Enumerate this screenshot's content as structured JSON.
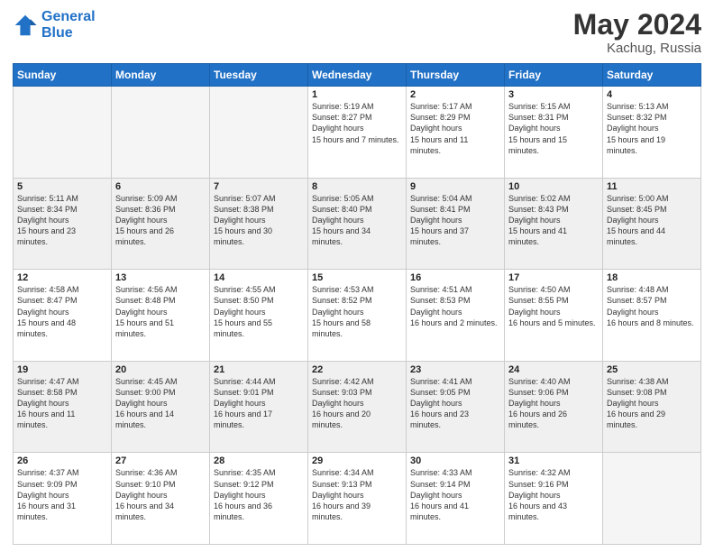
{
  "header": {
    "logo_line1": "General",
    "logo_line2": "Blue",
    "title": "May 2024",
    "location": "Kachug, Russia"
  },
  "days_of_week": [
    "Sunday",
    "Monday",
    "Tuesday",
    "Wednesday",
    "Thursday",
    "Friday",
    "Saturday"
  ],
  "weeks": [
    [
      {
        "day": "",
        "sunrise": "",
        "sunset": "",
        "daylight": "",
        "empty": true
      },
      {
        "day": "",
        "sunrise": "",
        "sunset": "",
        "daylight": "",
        "empty": true
      },
      {
        "day": "",
        "sunrise": "",
        "sunset": "",
        "daylight": "",
        "empty": true
      },
      {
        "day": "1",
        "sunrise": "5:19 AM",
        "sunset": "8:27 PM",
        "daylight": "15 hours and 7 minutes."
      },
      {
        "day": "2",
        "sunrise": "5:17 AM",
        "sunset": "8:29 PM",
        "daylight": "15 hours and 11 minutes."
      },
      {
        "day": "3",
        "sunrise": "5:15 AM",
        "sunset": "8:31 PM",
        "daylight": "15 hours and 15 minutes."
      },
      {
        "day": "4",
        "sunrise": "5:13 AM",
        "sunset": "8:32 PM",
        "daylight": "15 hours and 19 minutes."
      }
    ],
    [
      {
        "day": "5",
        "sunrise": "5:11 AM",
        "sunset": "8:34 PM",
        "daylight": "15 hours and 23 minutes."
      },
      {
        "day": "6",
        "sunrise": "5:09 AM",
        "sunset": "8:36 PM",
        "daylight": "15 hours and 26 minutes."
      },
      {
        "day": "7",
        "sunrise": "5:07 AM",
        "sunset": "8:38 PM",
        "daylight": "15 hours and 30 minutes."
      },
      {
        "day": "8",
        "sunrise": "5:05 AM",
        "sunset": "8:40 PM",
        "daylight": "15 hours and 34 minutes."
      },
      {
        "day": "9",
        "sunrise": "5:04 AM",
        "sunset": "8:41 PM",
        "daylight": "15 hours and 37 minutes."
      },
      {
        "day": "10",
        "sunrise": "5:02 AM",
        "sunset": "8:43 PM",
        "daylight": "15 hours and 41 minutes."
      },
      {
        "day": "11",
        "sunrise": "5:00 AM",
        "sunset": "8:45 PM",
        "daylight": "15 hours and 44 minutes."
      }
    ],
    [
      {
        "day": "12",
        "sunrise": "4:58 AM",
        "sunset": "8:47 PM",
        "daylight": "15 hours and 48 minutes."
      },
      {
        "day": "13",
        "sunrise": "4:56 AM",
        "sunset": "8:48 PM",
        "daylight": "15 hours and 51 minutes."
      },
      {
        "day": "14",
        "sunrise": "4:55 AM",
        "sunset": "8:50 PM",
        "daylight": "15 hours and 55 minutes."
      },
      {
        "day": "15",
        "sunrise": "4:53 AM",
        "sunset": "8:52 PM",
        "daylight": "15 hours and 58 minutes."
      },
      {
        "day": "16",
        "sunrise": "4:51 AM",
        "sunset": "8:53 PM",
        "daylight": "16 hours and 2 minutes."
      },
      {
        "day": "17",
        "sunrise": "4:50 AM",
        "sunset": "8:55 PM",
        "daylight": "16 hours and 5 minutes."
      },
      {
        "day": "18",
        "sunrise": "4:48 AM",
        "sunset": "8:57 PM",
        "daylight": "16 hours and 8 minutes."
      }
    ],
    [
      {
        "day": "19",
        "sunrise": "4:47 AM",
        "sunset": "8:58 PM",
        "daylight": "16 hours and 11 minutes."
      },
      {
        "day": "20",
        "sunrise": "4:45 AM",
        "sunset": "9:00 PM",
        "daylight": "16 hours and 14 minutes."
      },
      {
        "day": "21",
        "sunrise": "4:44 AM",
        "sunset": "9:01 PM",
        "daylight": "16 hours and 17 minutes."
      },
      {
        "day": "22",
        "sunrise": "4:42 AM",
        "sunset": "9:03 PM",
        "daylight": "16 hours and 20 minutes."
      },
      {
        "day": "23",
        "sunrise": "4:41 AM",
        "sunset": "9:05 PM",
        "daylight": "16 hours and 23 minutes."
      },
      {
        "day": "24",
        "sunrise": "4:40 AM",
        "sunset": "9:06 PM",
        "daylight": "16 hours and 26 minutes."
      },
      {
        "day": "25",
        "sunrise": "4:38 AM",
        "sunset": "9:08 PM",
        "daylight": "16 hours and 29 minutes."
      }
    ],
    [
      {
        "day": "26",
        "sunrise": "4:37 AM",
        "sunset": "9:09 PM",
        "daylight": "16 hours and 31 minutes."
      },
      {
        "day": "27",
        "sunrise": "4:36 AM",
        "sunset": "9:10 PM",
        "daylight": "16 hours and 34 minutes."
      },
      {
        "day": "28",
        "sunrise": "4:35 AM",
        "sunset": "9:12 PM",
        "daylight": "16 hours and 36 minutes."
      },
      {
        "day": "29",
        "sunrise": "4:34 AM",
        "sunset": "9:13 PM",
        "daylight": "16 hours and 39 minutes."
      },
      {
        "day": "30",
        "sunrise": "4:33 AM",
        "sunset": "9:14 PM",
        "daylight": "16 hours and 41 minutes."
      },
      {
        "day": "31",
        "sunrise": "4:32 AM",
        "sunset": "9:16 PM",
        "daylight": "16 hours and 43 minutes."
      },
      {
        "day": "",
        "sunrise": "",
        "sunset": "",
        "daylight": "",
        "empty": true
      }
    ]
  ]
}
